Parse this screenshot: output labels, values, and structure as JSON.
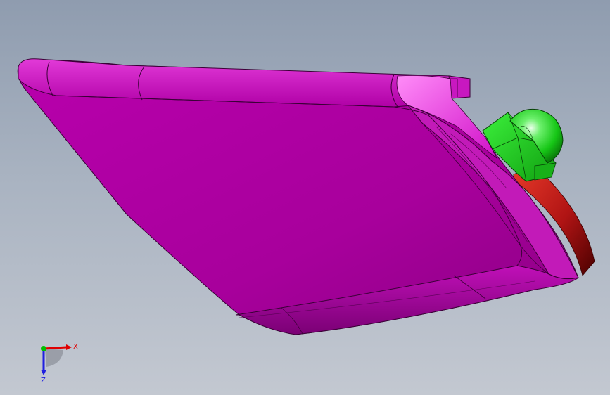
{
  "viewport": {
    "background_top": "#8f9caf",
    "background_bottom": "#c3c8d1"
  },
  "model": {
    "housing_color": "#b200a6",
    "housing_highlight": "#e020d8",
    "nut_color": "#22dd22",
    "washer_color": "#c01818"
  },
  "triad": {
    "x_label": "X",
    "z_label": "Z",
    "x_color": "#e00000",
    "y_color": "#00c000",
    "z_color": "#2020e0"
  }
}
